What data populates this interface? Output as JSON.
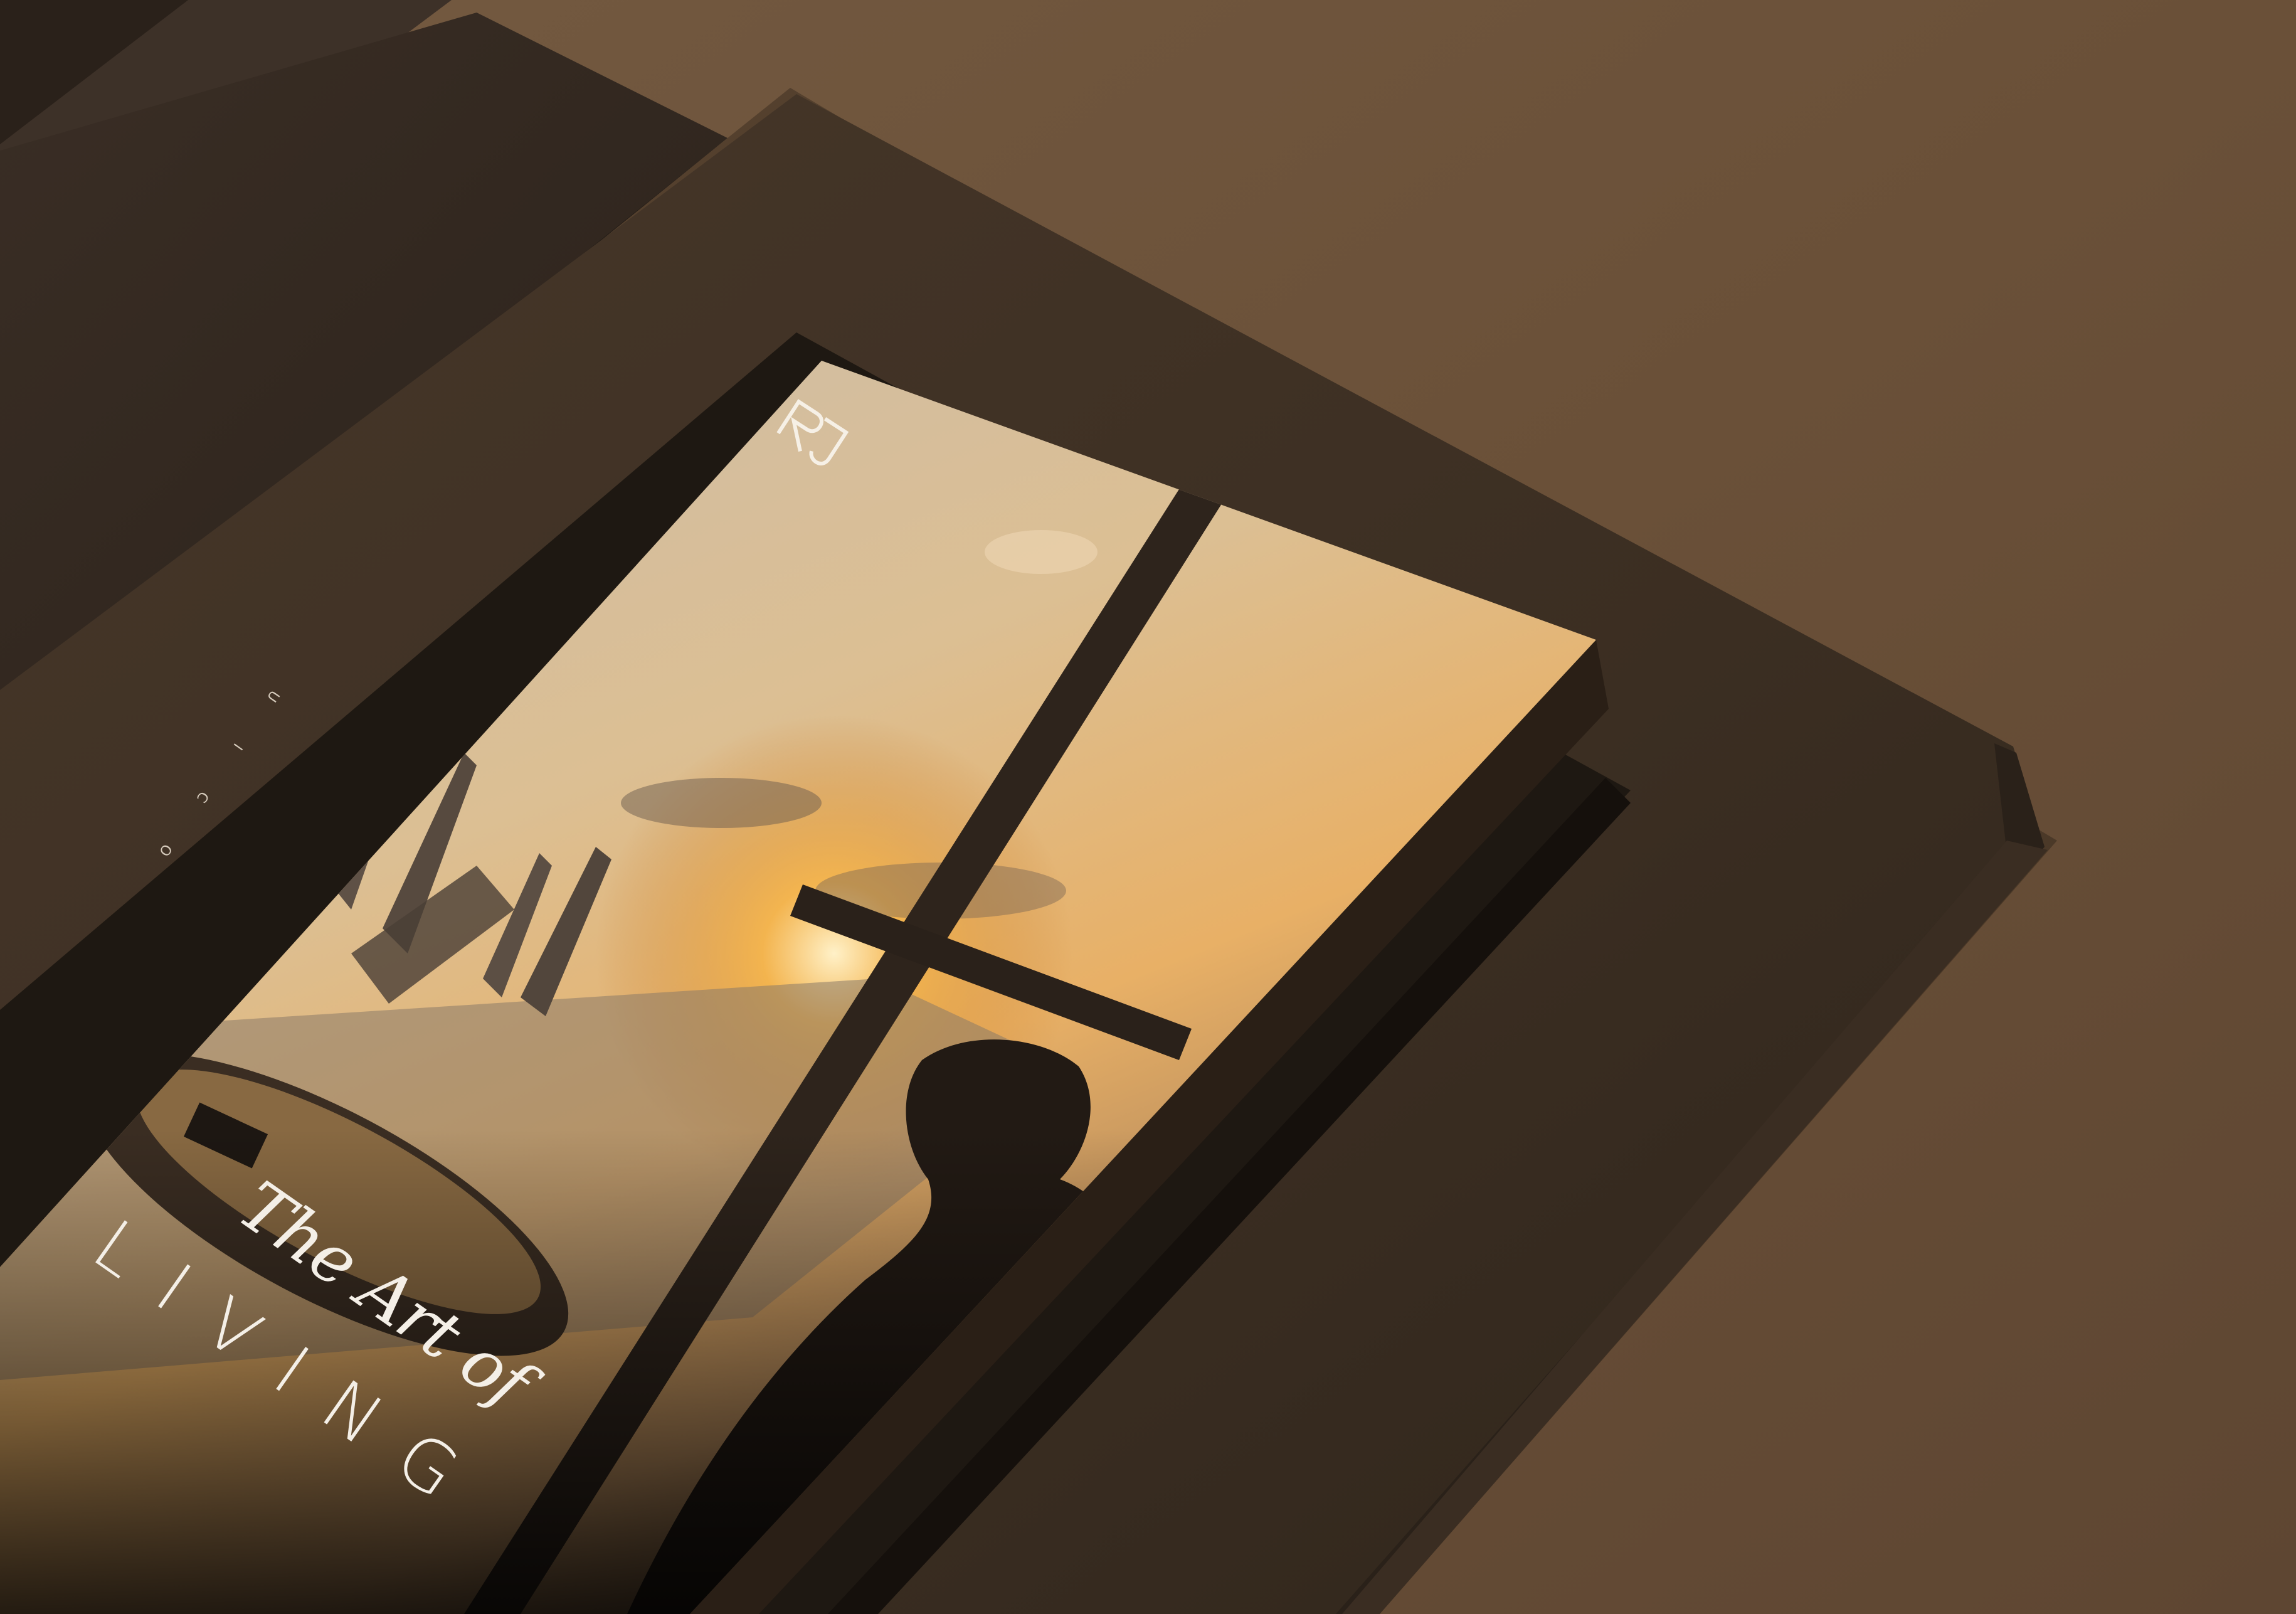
{
  "scene": {
    "subject": "book cover mockup in presentation box",
    "colors": {
      "background": "#6b5139",
      "box": "#3d3024",
      "sky_top": "#d8c3a4",
      "sun": "#f3a43a",
      "accent": "#e0463c"
    }
  },
  "cover": {
    "title_line1": "The Art of",
    "title_line2": "LIVING",
    "vertical_text": "U I C O",
    "logo_icon": "monogram-logo-icon"
  }
}
